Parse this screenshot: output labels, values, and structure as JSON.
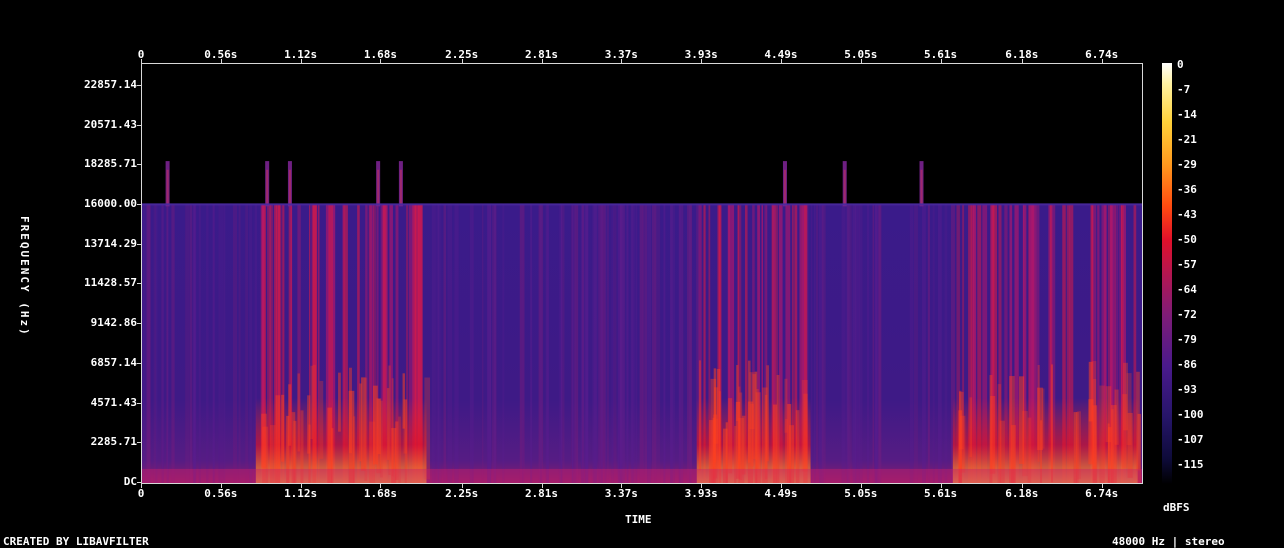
{
  "chart_data": {
    "type": "heatmap",
    "xlabel": "TIME",
    "ylabel": "FREQUENCY (Hz)",
    "x_ticks": [
      "0",
      "0.56s",
      "1.12s",
      "1.68s",
      "2.25s",
      "2.81s",
      "3.37s",
      "3.93s",
      "4.49s",
      "5.05s",
      "5.61s",
      "6.18s",
      "6.74s"
    ],
    "x_tick_values": [
      0,
      0.56,
      1.12,
      1.68,
      2.25,
      2.81,
      3.37,
      3.93,
      4.49,
      5.05,
      5.61,
      6.18,
      6.74
    ],
    "xlim": [
      0,
      7.03
    ],
    "y_ticks": [
      "22857.14",
      "20571.43",
      "18285.71",
      "16000.00",
      "13714.29",
      "11428.57",
      "9142.86",
      "6857.14",
      "4571.43",
      "2285.71",
      "DC"
    ],
    "y_tick_values": [
      22857.14,
      20571.43,
      18285.71,
      16000,
      13714.29,
      11428.57,
      9142.86,
      6857.14,
      4571.43,
      2285.71,
      0
    ],
    "ylim": [
      0,
      24000
    ],
    "colorbar_ticks": [
      "0",
      "-7",
      "-14",
      "-21",
      "-29",
      "-36",
      "-43",
      "-50",
      "-57",
      "-64",
      "-72",
      "-79",
      "-86",
      "-93",
      "-100",
      "-107",
      "-115"
    ],
    "colorbar_label": "dBFS",
    "colorbar_range": [
      -120,
      0
    ],
    "cutoff_frequency_hz": 16000,
    "loud_segments_s": [
      [
        0.8,
        2.0
      ],
      [
        3.9,
        4.7
      ],
      [
        5.7,
        7.0
      ]
    ],
    "bursts_above_cutoff_s": [
      0.18,
      0.88,
      1.04,
      1.66,
      1.82,
      4.52,
      4.94,
      5.48
    ]
  },
  "footer": {
    "created_by": "CREATED BY LIBAVFILTER",
    "info": "48000 Hz | stereo"
  },
  "colors": {
    "background": "#000000",
    "axis": "#d8d8d8",
    "text": "#ffffff"
  }
}
